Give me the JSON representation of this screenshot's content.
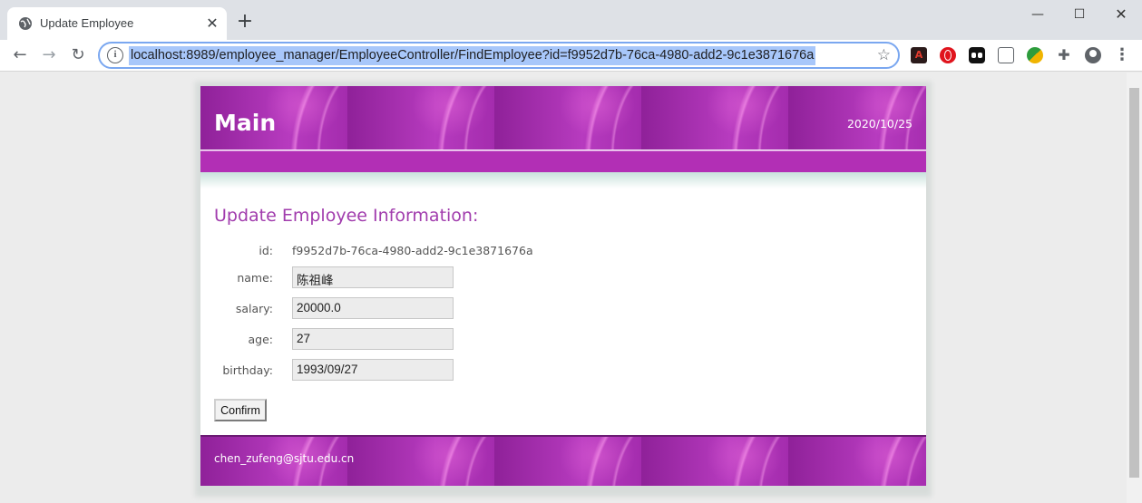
{
  "browser": {
    "tab_title": "Update Employee",
    "url": "localhost:8989/employee_manager/EmployeeController/FindEmployee?id=f9952d7b-76ca-4980-add2-9c1e3871676a"
  },
  "header": {
    "title": "Main",
    "date": "2020/10/25"
  },
  "form": {
    "heading": "Update Employee Information:",
    "id_label": "id:",
    "id_value": "f9952d7b-76ca-4980-add2-9c1e3871676a",
    "name_label": "name:",
    "name_value": "陈祖峰",
    "salary_label": "salary:",
    "salary_value": "20000.0",
    "age_label": "age:",
    "age_value": "27",
    "birthday_label": "birthday:",
    "birthday_value": "1993/09/27",
    "confirm_label": "Confirm"
  },
  "footer": {
    "email": "chen_zufeng@sjtu.edu.cn"
  },
  "icons": {
    "tab": "globe-icon",
    "close": "close-icon",
    "new_tab": "plus-icon",
    "back": "arrow-left-icon",
    "forward": "arrow-right-icon",
    "reload": "reload-icon",
    "info": "info-icon",
    "bookmark": "star-icon"
  },
  "colors": {
    "banner": "#9a2aa6",
    "heading": "#a13cad",
    "nav_bar": "#b22fb5",
    "url_selection": "#a8c7fa"
  }
}
